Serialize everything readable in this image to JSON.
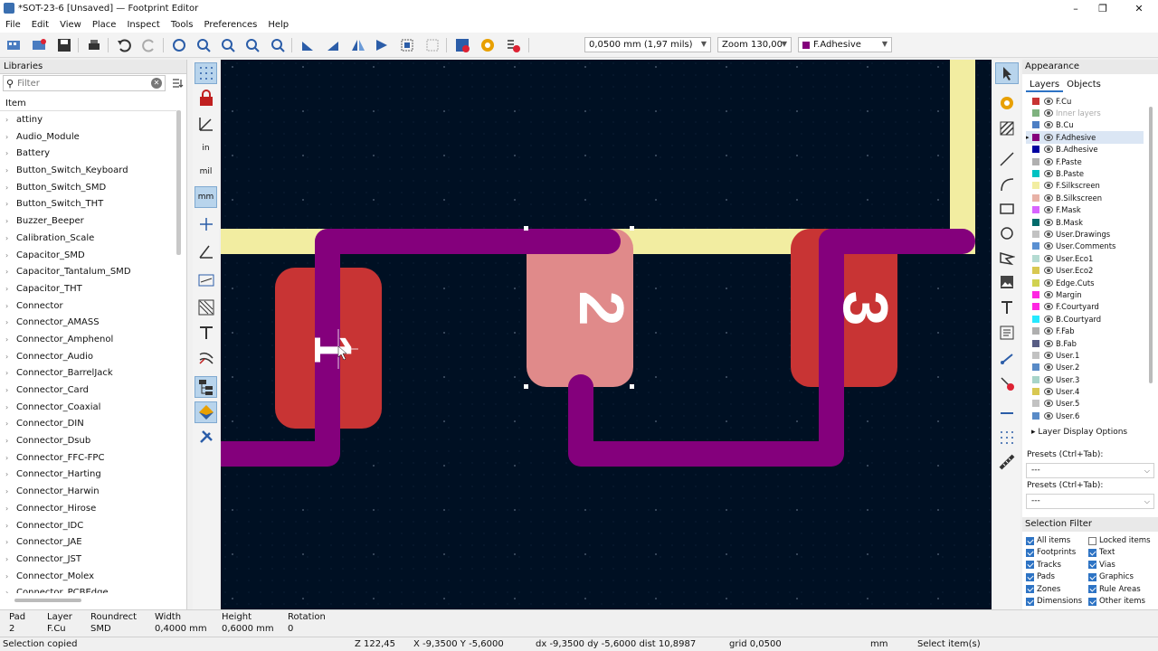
{
  "window": {
    "title": "*SOT-23-6 [Unsaved] — Footprint Editor",
    "controls": [
      "–",
      "❐",
      "✕"
    ]
  },
  "menu": [
    "File",
    "Edit",
    "View",
    "Place",
    "Inspect",
    "Tools",
    "Preferences",
    "Help"
  ],
  "toolbar": {
    "grid_select": "0,0500 mm (1,97 mils)",
    "zoom_select": "Zoom 130,00",
    "layer_select": "F.Adhesive",
    "layer_color": "#84007c"
  },
  "libraries": {
    "header": "Libraries",
    "filter_placeholder": "Filter",
    "column_header": "Item",
    "items": [
      "attiny",
      "Audio_Module",
      "Battery",
      "Button_Switch_Keyboard",
      "Button_Switch_SMD",
      "Button_Switch_THT",
      "Buzzer_Beeper",
      "Calibration_Scale",
      "Capacitor_SMD",
      "Capacitor_Tantalum_SMD",
      "Capacitor_THT",
      "Connector",
      "Connector_AMASS",
      "Connector_Amphenol",
      "Connector_Audio",
      "Connector_BarrelJack",
      "Connector_Card",
      "Connector_Coaxial",
      "Connector_DIN",
      "Connector_Dsub",
      "Connector_FFC-FPC",
      "Connector_Harting",
      "Connector_Harwin",
      "Connector_Hirose",
      "Connector_IDC",
      "Connector_JAE",
      "Connector_JST",
      "Connector_Molex",
      "Connector_PCBEdge"
    ]
  },
  "canvas": {
    "background": "#001023",
    "pads": [
      {
        "number": "1",
        "color": "#c83434"
      },
      {
        "number": "2",
        "color": "#e08a8a"
      },
      {
        "number": "3",
        "color": "#c83434"
      }
    ],
    "adhesive_color": "#84007c",
    "silkscreen_color": "#f2eda1"
  },
  "appearance": {
    "header": "Appearance",
    "tabs": [
      "Layers",
      "Objects"
    ],
    "layers": [
      {
        "name": "F.Cu",
        "color": "#c83434"
      },
      {
        "name": "Inner layers",
        "color": "#7fb27f",
        "dim": true
      },
      {
        "name": "B.Cu",
        "color": "#4d7fc4"
      },
      {
        "name": "F.Adhesive",
        "color": "#84007c",
        "active": true
      },
      {
        "name": "B.Adhesive",
        "color": "#0000a0"
      },
      {
        "name": "F.Paste",
        "color": "#b0b0b0"
      },
      {
        "name": "B.Paste",
        "color": "#00c2c2"
      },
      {
        "name": "F.Silkscreen",
        "color": "#f2eda1"
      },
      {
        "name": "B.Silkscreen",
        "color": "#e8b2a7"
      },
      {
        "name": "F.Mask",
        "color": "#d864ff"
      },
      {
        "name": "B.Mask",
        "color": "#026b6b"
      },
      {
        "name": "User.Drawings",
        "color": "#c2c2c2"
      },
      {
        "name": "User.Comments",
        "color": "#5a90d2"
      },
      {
        "name": "User.Eco1",
        "color": "#b4dbd2"
      },
      {
        "name": "User.Eco2",
        "color": "#d8c852"
      },
      {
        "name": "Edge.Cuts",
        "color": "#d0d250"
      },
      {
        "name": "Margin",
        "color": "#ff26e2"
      },
      {
        "name": "F.Courtyard",
        "color": "#ff26e2"
      },
      {
        "name": "B.Courtyard",
        "color": "#26e9ff"
      },
      {
        "name": "F.Fab",
        "color": "#afafaf"
      },
      {
        "name": "B.Fab",
        "color": "#585d84"
      },
      {
        "name": "User.1",
        "color": "#c2c2c2"
      },
      {
        "name": "User.2",
        "color": "#598bc7"
      },
      {
        "name": "User.3",
        "color": "#a7d4c9"
      },
      {
        "name": "User.4",
        "color": "#d8c852"
      },
      {
        "name": "User.5",
        "color": "#c2c2c2"
      },
      {
        "name": "User.6",
        "color": "#598bc7"
      }
    ],
    "layer_display_options": "Layer Display Options",
    "presets_label_1": "Presets (Ctrl+Tab):",
    "presets_value_1": "---",
    "presets_label_2": "Presets (Ctrl+Tab):",
    "presets_value_2": "---"
  },
  "selection_filter": {
    "header": "Selection Filter",
    "left": [
      {
        "label": "All items",
        "checked": true
      },
      {
        "label": "Footprints",
        "checked": true
      },
      {
        "label": "Tracks",
        "checked": true
      },
      {
        "label": "Pads",
        "checked": true
      },
      {
        "label": "Zones",
        "checked": true
      },
      {
        "label": "Dimensions",
        "checked": true
      }
    ],
    "right": [
      {
        "label": "Locked items",
        "checked": false
      },
      {
        "label": "Text",
        "checked": true
      },
      {
        "label": "Vias",
        "checked": true
      },
      {
        "label": "Graphics",
        "checked": true
      },
      {
        "label": "Rule Areas",
        "checked": true
      },
      {
        "label": "Other items",
        "checked": true
      }
    ]
  },
  "message_panel": {
    "pad_label": "Pad",
    "pad_value": "2",
    "layer_label": "Layer",
    "layer_value": "F.Cu",
    "shape_label": "Roundrect",
    "shape_value": "SMD",
    "width_label": "Width",
    "width_value": "0,4000 mm",
    "height_label": "Height",
    "height_value": "0,6000 mm",
    "rotation_label": "Rotation",
    "rotation_value": "0"
  },
  "status": {
    "message": "Selection copied",
    "zoom": "Z 122,45",
    "xy": "X -9,3500  Y -5,6000",
    "delta": "dx -9,3500  dy -5,6000  dist 10,8987",
    "grid": "grid 0,0500",
    "units": "mm",
    "action": "Select item(s)"
  }
}
